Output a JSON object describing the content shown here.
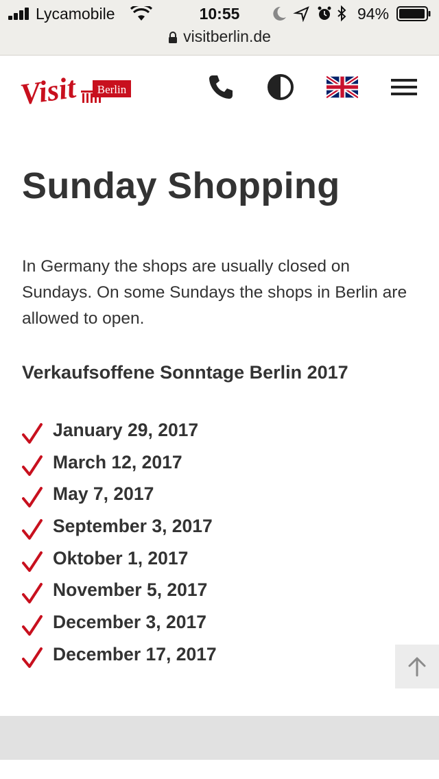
{
  "status_bar": {
    "carrier": "Lycamobile",
    "time": "10:55",
    "battery_percent": "94%",
    "icons": [
      "signal-icon",
      "wifi-icon",
      "moon-icon",
      "location-icon",
      "alarm-icon",
      "bluetooth-icon",
      "battery-icon"
    ]
  },
  "url_bar": {
    "domain": "visitberlin.de",
    "icon": "lock-icon"
  },
  "header": {
    "logo_text": "Visit",
    "logo_city": "Berlin",
    "icons": [
      "phone-icon",
      "contrast-icon",
      "uk-flag-icon",
      "hamburger-menu-icon"
    ]
  },
  "main": {
    "title": "Sunday Shopping",
    "intro": "In Germany the shops are usually closed on Sundays. On some Sundays the shops in Berlin are allowed to open.",
    "subtitle": "Verkaufsoffene Sonntage Berlin 2017",
    "dates": [
      "January 29, 2017",
      "March 12, 2017",
      "May 7, 2017",
      "September 3, 2017",
      "Oktober 1, 2017",
      "November 5, 2017",
      "December 3, 2017",
      "December 17, 2017"
    ]
  },
  "scroll_top": {
    "icon": "arrow-up-icon"
  },
  "colors": {
    "brand_red": "#c8101e",
    "text": "#333333",
    "status_bg": "#efeeea",
    "footer_bg": "#e1e1e1"
  }
}
